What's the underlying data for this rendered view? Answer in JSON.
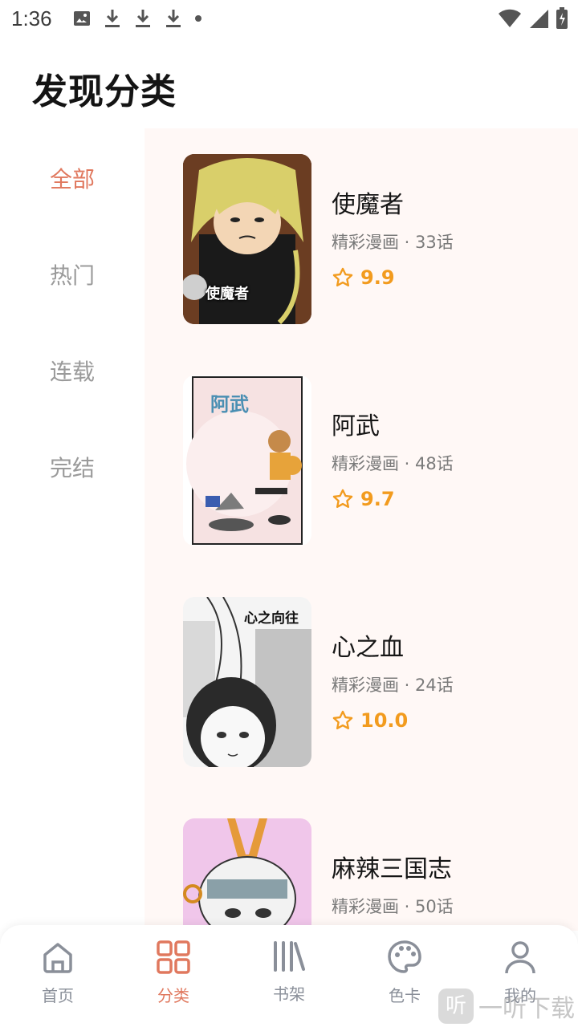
{
  "status_bar": {
    "time": "1:36"
  },
  "header": {
    "title": "发现分类"
  },
  "sidebar": {
    "items": [
      {
        "label": "全部",
        "active": true
      },
      {
        "label": "热门",
        "active": false
      },
      {
        "label": "连载",
        "active": false
      },
      {
        "label": "完结",
        "active": false
      }
    ]
  },
  "comics": [
    {
      "title": "使魔者",
      "meta": "精彩漫画 · 33话",
      "rating": "9.9",
      "cover_text": "使魔者"
    },
    {
      "title": "阿武",
      "meta": "精彩漫画 · 48话",
      "rating": "9.7",
      "cover_text": "阿武"
    },
    {
      "title": "心之血",
      "meta": "精彩漫画 · 24话",
      "rating": "10.0",
      "cover_text": "心之向往"
    },
    {
      "title": "麻辣三国志",
      "meta": "精彩漫画 · 50话",
      "rating": "",
      "cover_text": ""
    }
  ],
  "bottom_nav": {
    "items": [
      {
        "label": "首页",
        "icon": "home-icon",
        "active": false
      },
      {
        "label": "分类",
        "icon": "grid-icon",
        "active": true
      },
      {
        "label": "书架",
        "icon": "bookshelf-icon",
        "active": false
      },
      {
        "label": "色卡",
        "icon": "palette-icon",
        "active": false
      },
      {
        "label": "我的",
        "icon": "user-icon",
        "active": false
      }
    ]
  },
  "watermark": {
    "text": "一听下载",
    "icon_text": "听"
  },
  "colors": {
    "accent": "#e0785e",
    "rating": "#f29b1e",
    "content_bg": "#fff8f6"
  }
}
